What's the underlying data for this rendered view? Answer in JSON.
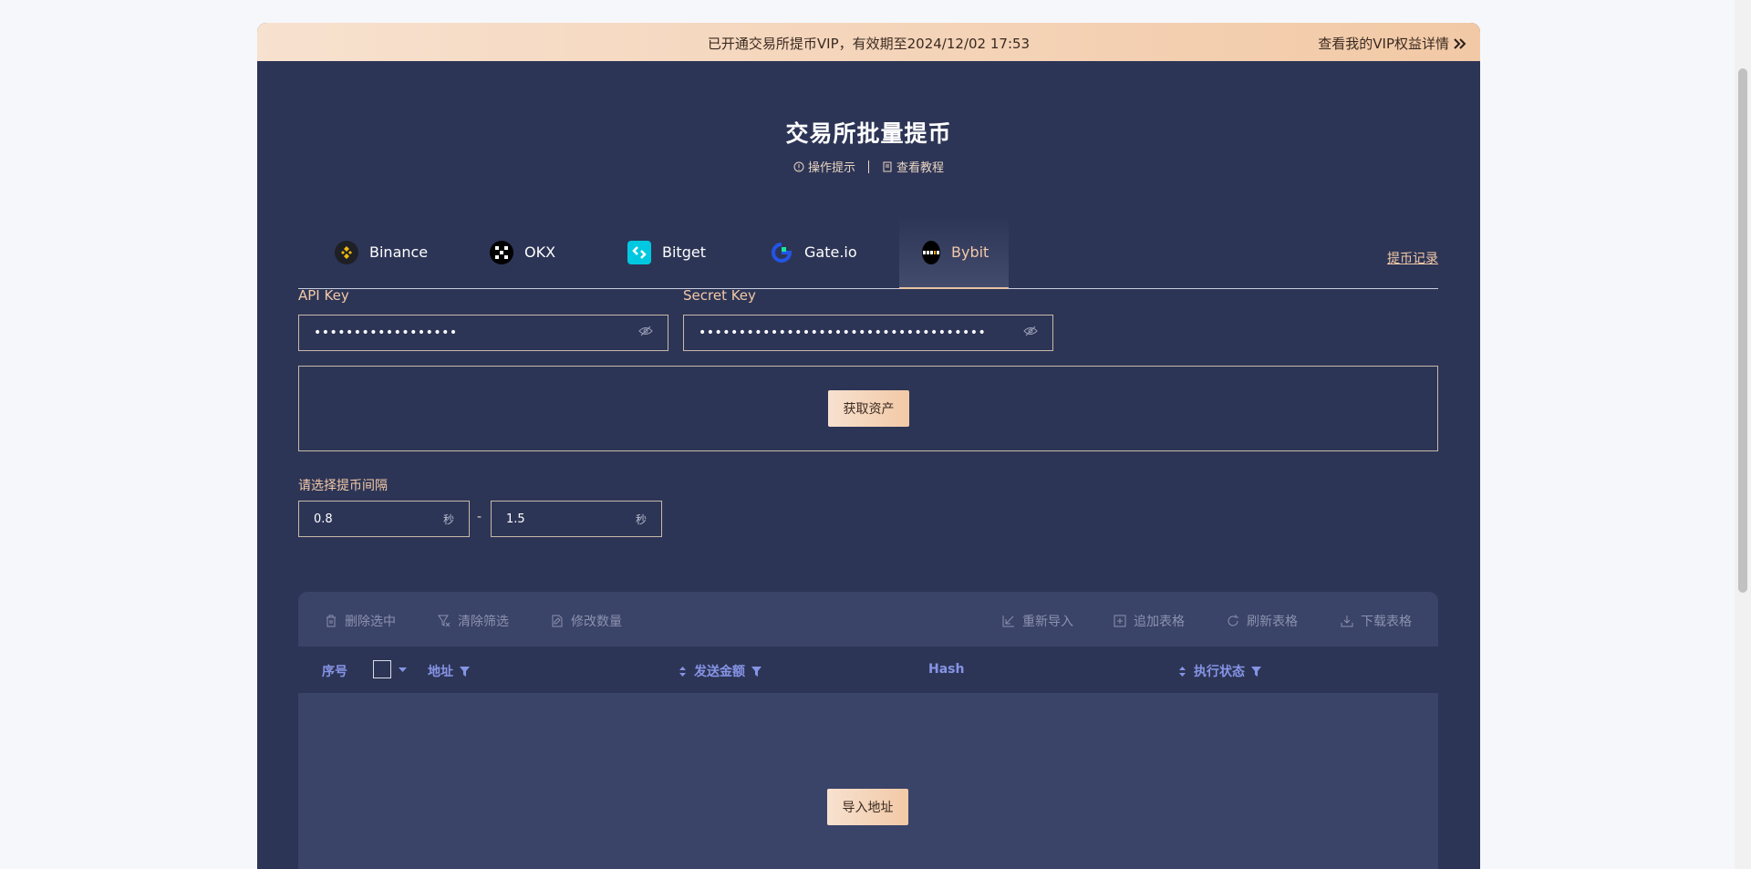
{
  "vip_bar": {
    "notice": "已开通交易所提币VIP，有效期至2024/12/02 17:53",
    "details_link": "查看我的VIP权益详情"
  },
  "header": {
    "title": "交易所批量提币",
    "tips_link": "操作提示",
    "tutorial_link": "查看教程"
  },
  "tabs": [
    {
      "label": "Binance",
      "icon": "binance-icon"
    },
    {
      "label": "OKX",
      "icon": "okx-icon"
    },
    {
      "label": "Bitget",
      "icon": "bitget-icon"
    },
    {
      "label": "Gate.io",
      "icon": "gateio-icon"
    },
    {
      "label": "Bybit",
      "icon": "bybit-icon",
      "active": true
    }
  ],
  "record_link": "提币记录",
  "api": {
    "api_key_label": "API Key",
    "api_key_value": "••••••••••••••••••",
    "secret_key_label": "Secret Key",
    "secret_key_value": "••••••••••••••••••••••••••••••••••••"
  },
  "fetch_assets_button": "获取资产",
  "interval": {
    "label": "请选择提币间隔",
    "min": "0.8",
    "max": "1.5",
    "unit": "秒",
    "separator": "-"
  },
  "toolbar": {
    "delete_selected": "删除选中",
    "clear_filter": "清除筛选",
    "edit_amount": "修改数量",
    "reimport": "重新导入",
    "append_table": "追加表格",
    "refresh_table": "刷新表格",
    "download_table": "下载表格"
  },
  "table": {
    "columns": {
      "index": "序号",
      "address": "地址",
      "amount": "发送金额",
      "hash": "Hash",
      "status": "执行状态"
    }
  },
  "import_button": "导入地址",
  "colors": {
    "panel": "#2d3556",
    "accent": "#f2c9a6",
    "table_header_text": "#8694e6"
  }
}
